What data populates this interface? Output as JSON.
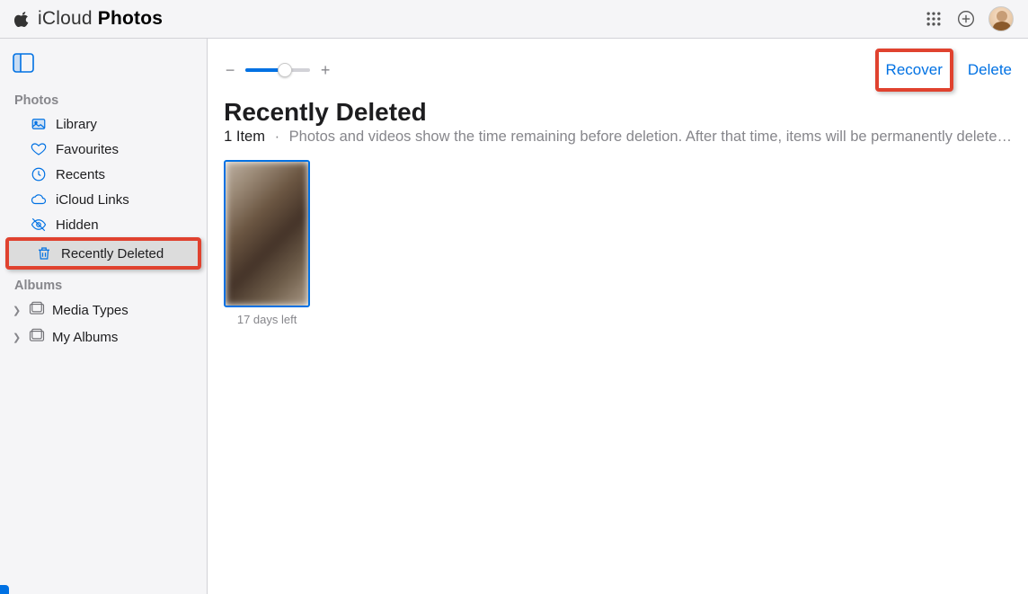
{
  "header": {
    "brand_light": "iCloud ",
    "brand_bold": "Photos"
  },
  "sidebar": {
    "section_photos": "Photos",
    "items": [
      {
        "label": "Library"
      },
      {
        "label": "Favourites"
      },
      {
        "label": "Recents"
      },
      {
        "label": "iCloud Links"
      },
      {
        "label": "Hidden"
      },
      {
        "label": "Recently Deleted"
      }
    ],
    "section_albums": "Albums",
    "albums": [
      {
        "label": "Media Types"
      },
      {
        "label": "My Albums"
      }
    ]
  },
  "toolbar": {
    "recover_label": "Recover",
    "delete_label": "Delete"
  },
  "page": {
    "title": "Recently Deleted",
    "count_text": "1 Item",
    "description": "Photos and videos show the time remaining before deletion. After that time, items will be permanently delete…"
  },
  "grid": {
    "items": [
      {
        "caption": "17 days left"
      }
    ]
  }
}
